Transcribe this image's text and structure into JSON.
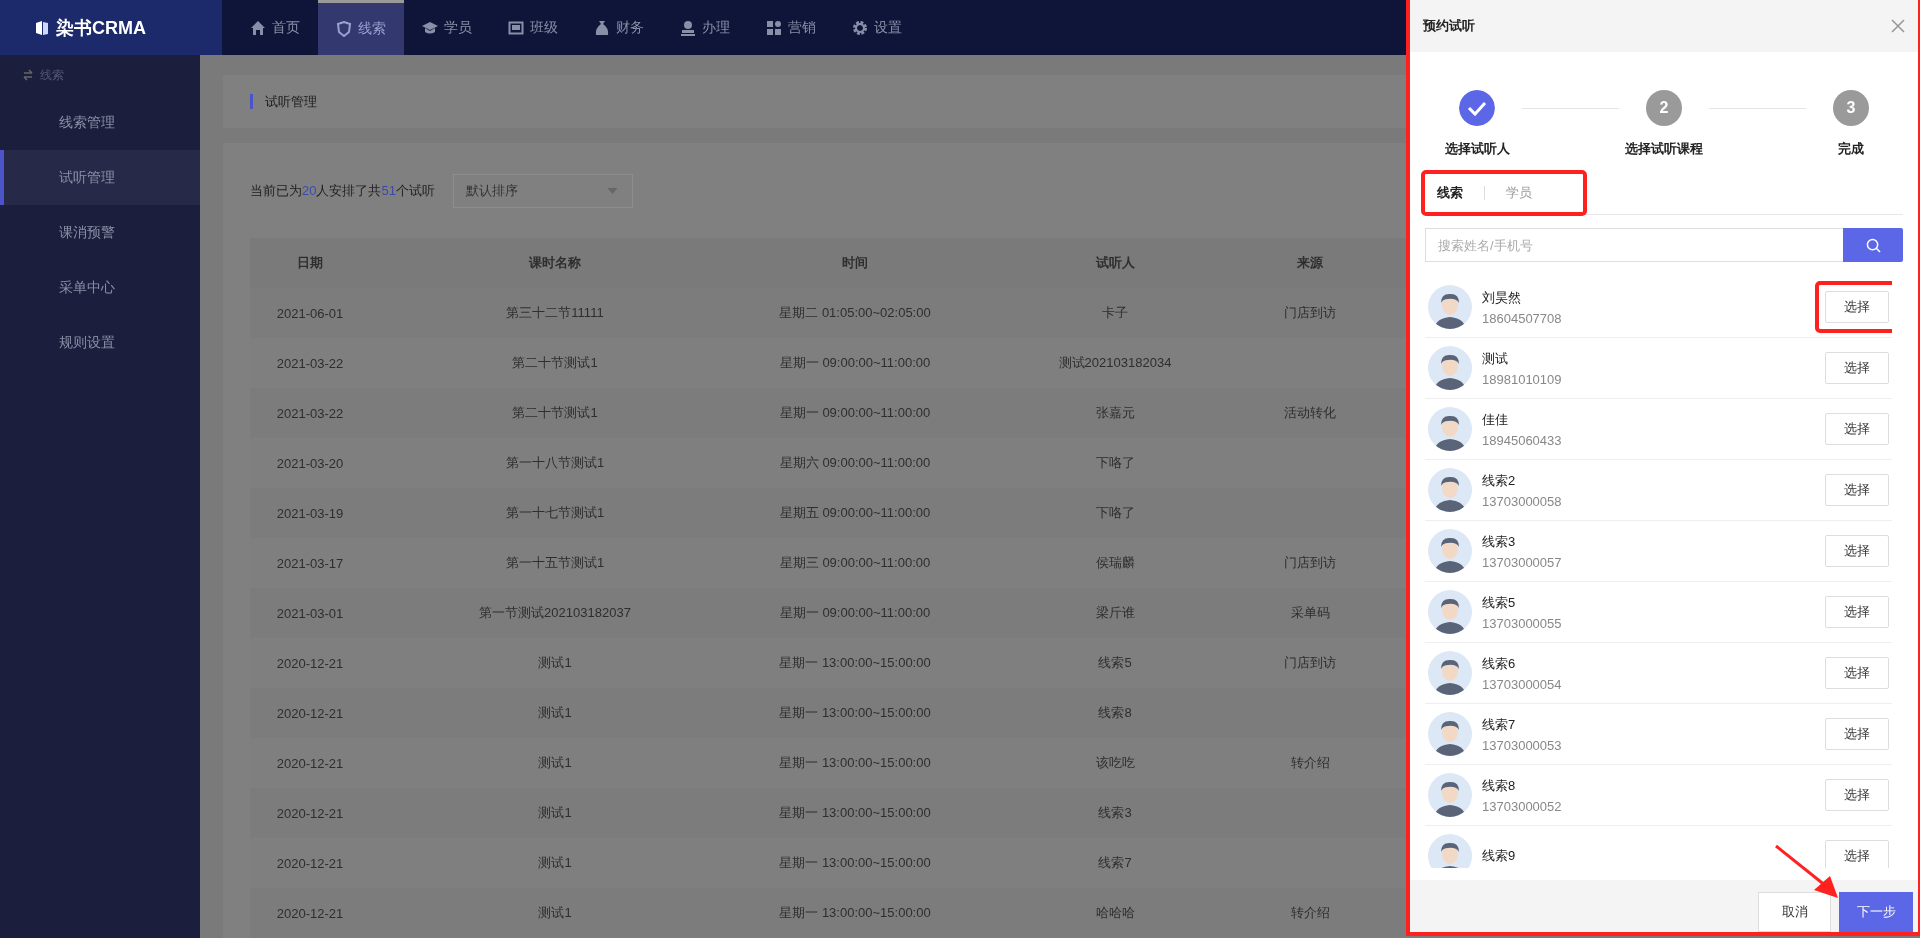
{
  "logo": {
    "text": "染书CRMA"
  },
  "nav": [
    {
      "label": "首页",
      "selected": false
    },
    {
      "label": "线索",
      "selected": true
    },
    {
      "label": "学员",
      "selected": false
    },
    {
      "label": "班级",
      "selected": false
    },
    {
      "label": "财务",
      "selected": false
    },
    {
      "label": "办理",
      "selected": false
    },
    {
      "label": "营销",
      "selected": false
    },
    {
      "label": "设置",
      "selected": false
    }
  ],
  "sidebar": {
    "title": "线索",
    "items": [
      {
        "label": "线索管理",
        "selected": false
      },
      {
        "label": "试听管理",
        "selected": true
      },
      {
        "label": "课消预警",
        "selected": false
      },
      {
        "label": "采单中心",
        "selected": false
      },
      {
        "label": "规则设置",
        "selected": false
      }
    ]
  },
  "breadcrumb": "试听管理",
  "summary": [
    {
      "kind": "text",
      "text": "当前已为"
    },
    {
      "kind": "number",
      "text": "20"
    },
    {
      "kind": "text",
      "text": "人安排了共"
    },
    {
      "kind": "number",
      "text": "51"
    },
    {
      "kind": "text",
      "text": "个试听"
    }
  ],
  "sort_select": {
    "value": "默认排序"
  },
  "table": {
    "columns": [
      "日期",
      "课时名称",
      "时间",
      "试听人",
      "来源"
    ],
    "rows": [
      [
        "2021-06-01",
        "第三十二节11111",
        "星期二 01:05:00~02:05:00",
        "卡子",
        "门店到访"
      ],
      [
        "2021-03-22",
        "第二十节测试1",
        "星期一 09:00:00~11:00:00",
        "测试202103182034",
        ""
      ],
      [
        "2021-03-22",
        "第二十节测试1",
        "星期一 09:00:00~11:00:00",
        "张嘉元",
        "活动转化"
      ],
      [
        "2021-03-20",
        "第一十八节测试1",
        "星期六 09:00:00~11:00:00",
        "下咯了",
        ""
      ],
      [
        "2021-03-19",
        "第一十七节测试1",
        "星期五 09:00:00~11:00:00",
        "下咯了",
        ""
      ],
      [
        "2021-03-17",
        "第一十五节测试1",
        "星期三 09:00:00~11:00:00",
        "侯瑞麟",
        "门店到访"
      ],
      [
        "2021-03-01",
        "第一节测试202103182037",
        "星期一 09:00:00~11:00:00",
        "梁斤谁",
        "采单码"
      ],
      [
        "2020-12-21",
        "测试1",
        "星期一 13:00:00~15:00:00",
        "线索5",
        "门店到访"
      ],
      [
        "2020-12-21",
        "测试1",
        "星期一 13:00:00~15:00:00",
        "线索8",
        ""
      ],
      [
        "2020-12-21",
        "测试1",
        "星期一 13:00:00~15:00:00",
        "该吃吃",
        "转介绍"
      ],
      [
        "2020-12-21",
        "测试1",
        "星期一 13:00:00~15:00:00",
        "线索3",
        ""
      ],
      [
        "2020-12-21",
        "测试1",
        "星期一 13:00:00~15:00:00",
        "线索7",
        ""
      ],
      [
        "2020-12-21",
        "测试1",
        "星期一 13:00:00~15:00:00",
        "哈哈哈",
        "转介绍"
      ]
    ]
  },
  "drawer": {
    "title": "预约试听",
    "highlighted": true,
    "steps": [
      {
        "label": "选择试听人",
        "done": true
      },
      {
        "label": "选择试听课程",
        "done": false,
        "number": "2"
      },
      {
        "label": "完成",
        "done": false,
        "number": "3"
      }
    ],
    "tabs_highlighted": true,
    "tabs": [
      {
        "label": "线索",
        "selected": true
      },
      {
        "label": "学员",
        "selected": false
      }
    ],
    "search": {
      "placeholder": "搜索姓名/手机号"
    },
    "people": [
      {
        "name": "刘昊然",
        "phone": "18604507708",
        "button": "选择",
        "highlighted": true
      },
      {
        "name": "测试",
        "phone": "18981010109",
        "button": "选择",
        "highlighted": false
      },
      {
        "name": "佳佳",
        "phone": "18945060433",
        "button": "选择",
        "highlighted": false
      },
      {
        "name": "线索2",
        "phone": "13703000058",
        "button": "选择",
        "highlighted": false
      },
      {
        "name": "线索3",
        "phone": "13703000057",
        "button": "选择",
        "highlighted": false
      },
      {
        "name": "线索5",
        "phone": "13703000055",
        "button": "选择",
        "highlighted": false
      },
      {
        "name": "线索6",
        "phone": "13703000054",
        "button": "选择",
        "highlighted": false
      },
      {
        "name": "线索7",
        "phone": "13703000053",
        "button": "选择",
        "highlighted": false
      },
      {
        "name": "线索8",
        "phone": "13703000052",
        "button": "选择",
        "highlighted": false
      },
      {
        "name": "线索9",
        "button": "选择",
        "highlighted": false
      }
    ],
    "cancel": "取消",
    "next": {
      "label": "下一步",
      "pointed": true
    }
  }
}
